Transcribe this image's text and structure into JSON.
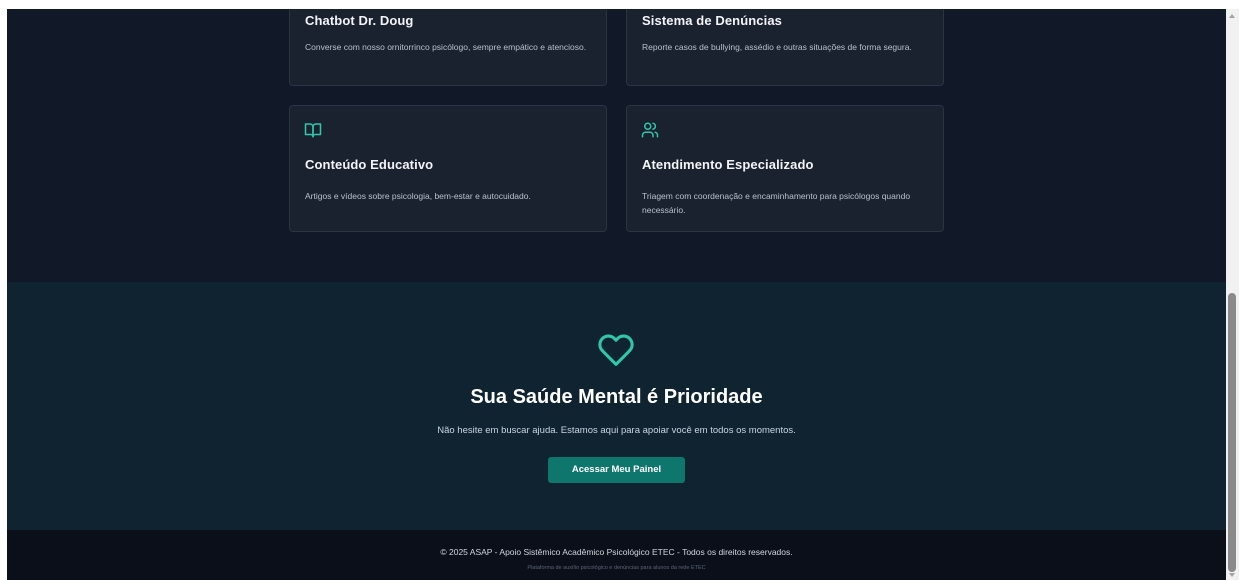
{
  "features": {
    "cards": [
      {
        "title": "Chatbot Dr. Doug",
        "description": "Converse com nosso ornitorrinco psicólogo, sempre empático e atencioso."
      },
      {
        "title": "Sistema de Denúncias",
        "description": "Reporte casos de bullying, assédio e outras situações de forma segura."
      },
      {
        "icon": "book-open-icon",
        "title": "Conteúdo Educativo",
        "description": "Artigos e vídeos sobre psicologia, bem-estar e autocuidado."
      },
      {
        "icon": "users-icon",
        "title": "Atendimento Especializado",
        "description": "Triagem com coordenação e encaminhamento para psicólogos quando necessário."
      }
    ]
  },
  "cta": {
    "icon": "heart-icon",
    "title": "Sua Saúde Mental é Prioridade",
    "subtitle": "Não hesite em buscar ajuda. Estamos aqui para apoiar você em todos os momentos.",
    "button_label": "Acessar Meu Painel"
  },
  "footer": {
    "copyright": "© 2025 ASAP - Apoio Sistêmico Acadêmico Psicológico ETEC - Todos os direitos reservados.",
    "tagline": "Plataforma de auxílio psicológico e denúncias para alunos da rede ETEC"
  },
  "colors": {
    "accent": "#2fc7a8",
    "button": "#0f766e",
    "page_bg": "#111827",
    "card_bg": "#1a2230",
    "cta_bg": "#0f2331",
    "footer_bg": "#0b0f1a"
  }
}
